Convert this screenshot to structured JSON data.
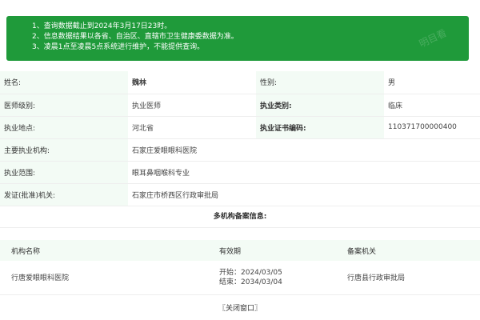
{
  "notice": {
    "lines": [
      "1、查询数据截止到2024年3月17日23时。",
      "2、信息数据结果以各省、自治区、直辖市卫生健康委数据为准。",
      "3、凌晨1点至凌晨5点系统进行维护，不能提供查询。"
    ],
    "watermark": "明目看"
  },
  "info": {
    "name_label": "姓名:",
    "name_value": "魏林",
    "gender_label": "性别:",
    "gender_value": "男",
    "level_label": "医师级别:",
    "level_value": "执业医师",
    "category_label": "执业类别:",
    "category_value": "临床",
    "location_label": "执业地点:",
    "location_value": "河北省",
    "cert_label": "执业证书编码:",
    "cert_value": "110371700000400",
    "institution_label": "主要执业机构:",
    "institution_value": "石家庄爱眼眼科医院",
    "scope_label": "执业范围:",
    "scope_value": "眼耳鼻咽喉科专业",
    "issuer_label": "发证(批准)机关:",
    "issuer_value": "石家庄市桥西区行政审批局"
  },
  "multi": {
    "title": "多机构备案信息:",
    "headers": [
      "机构名称",
      "有效期",
      "备案机关"
    ],
    "rows": [
      {
        "name": "行唐爱眼眼科医院",
        "start": "开始：2024/03/05",
        "end": "结束：2034/03/04",
        "authority": "行唐县行政审批局"
      }
    ]
  },
  "close_label": "〖关闭窗口〗"
}
